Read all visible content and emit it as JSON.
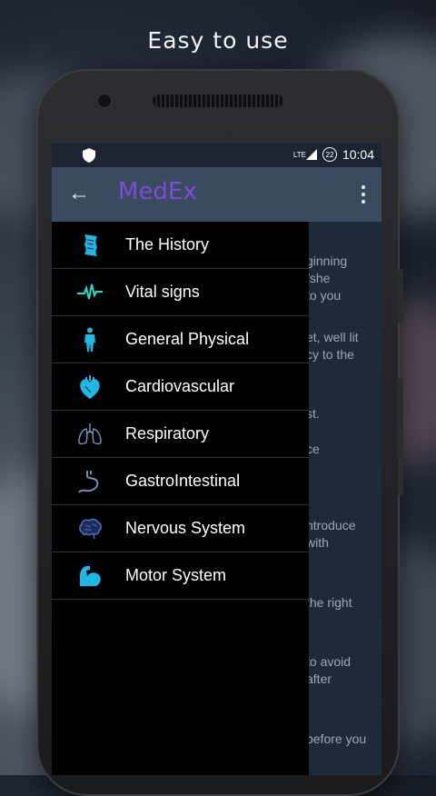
{
  "caption": "Easy to use",
  "status": {
    "network": "LTE",
    "battery": "22",
    "time": "10:04"
  },
  "appbar": {
    "title": "MedEx"
  },
  "drawer": {
    "items": [
      {
        "label": "The History",
        "icon": "scroll-icon"
      },
      {
        "label": "Vital signs",
        "icon": "heartbeat-icon"
      },
      {
        "label": "General Physical",
        "icon": "body-icon"
      },
      {
        "label": "Cardiovascular",
        "icon": "heart-icon"
      },
      {
        "label": "Respiratory",
        "icon": "lungs-icon"
      },
      {
        "label": "GastroIntestinal",
        "icon": "stomach-icon"
      },
      {
        "label": "Nervous System",
        "icon": "brain-icon"
      },
      {
        "label": "Motor System",
        "icon": "arm-icon"
      }
    ]
  },
  "background_content": [
    "ginning",
    "/she",
    "to you",
    "et, well lit",
    "cy to the",
    "st.",
    "ce",
    "ntroduce",
    "with",
    "the right",
    "to avoid",
    "after",
    "before you"
  ],
  "colors": {
    "accent": "#7a4dd6",
    "icon": "#1fb7e6",
    "appbar": "#3a4a5f"
  }
}
